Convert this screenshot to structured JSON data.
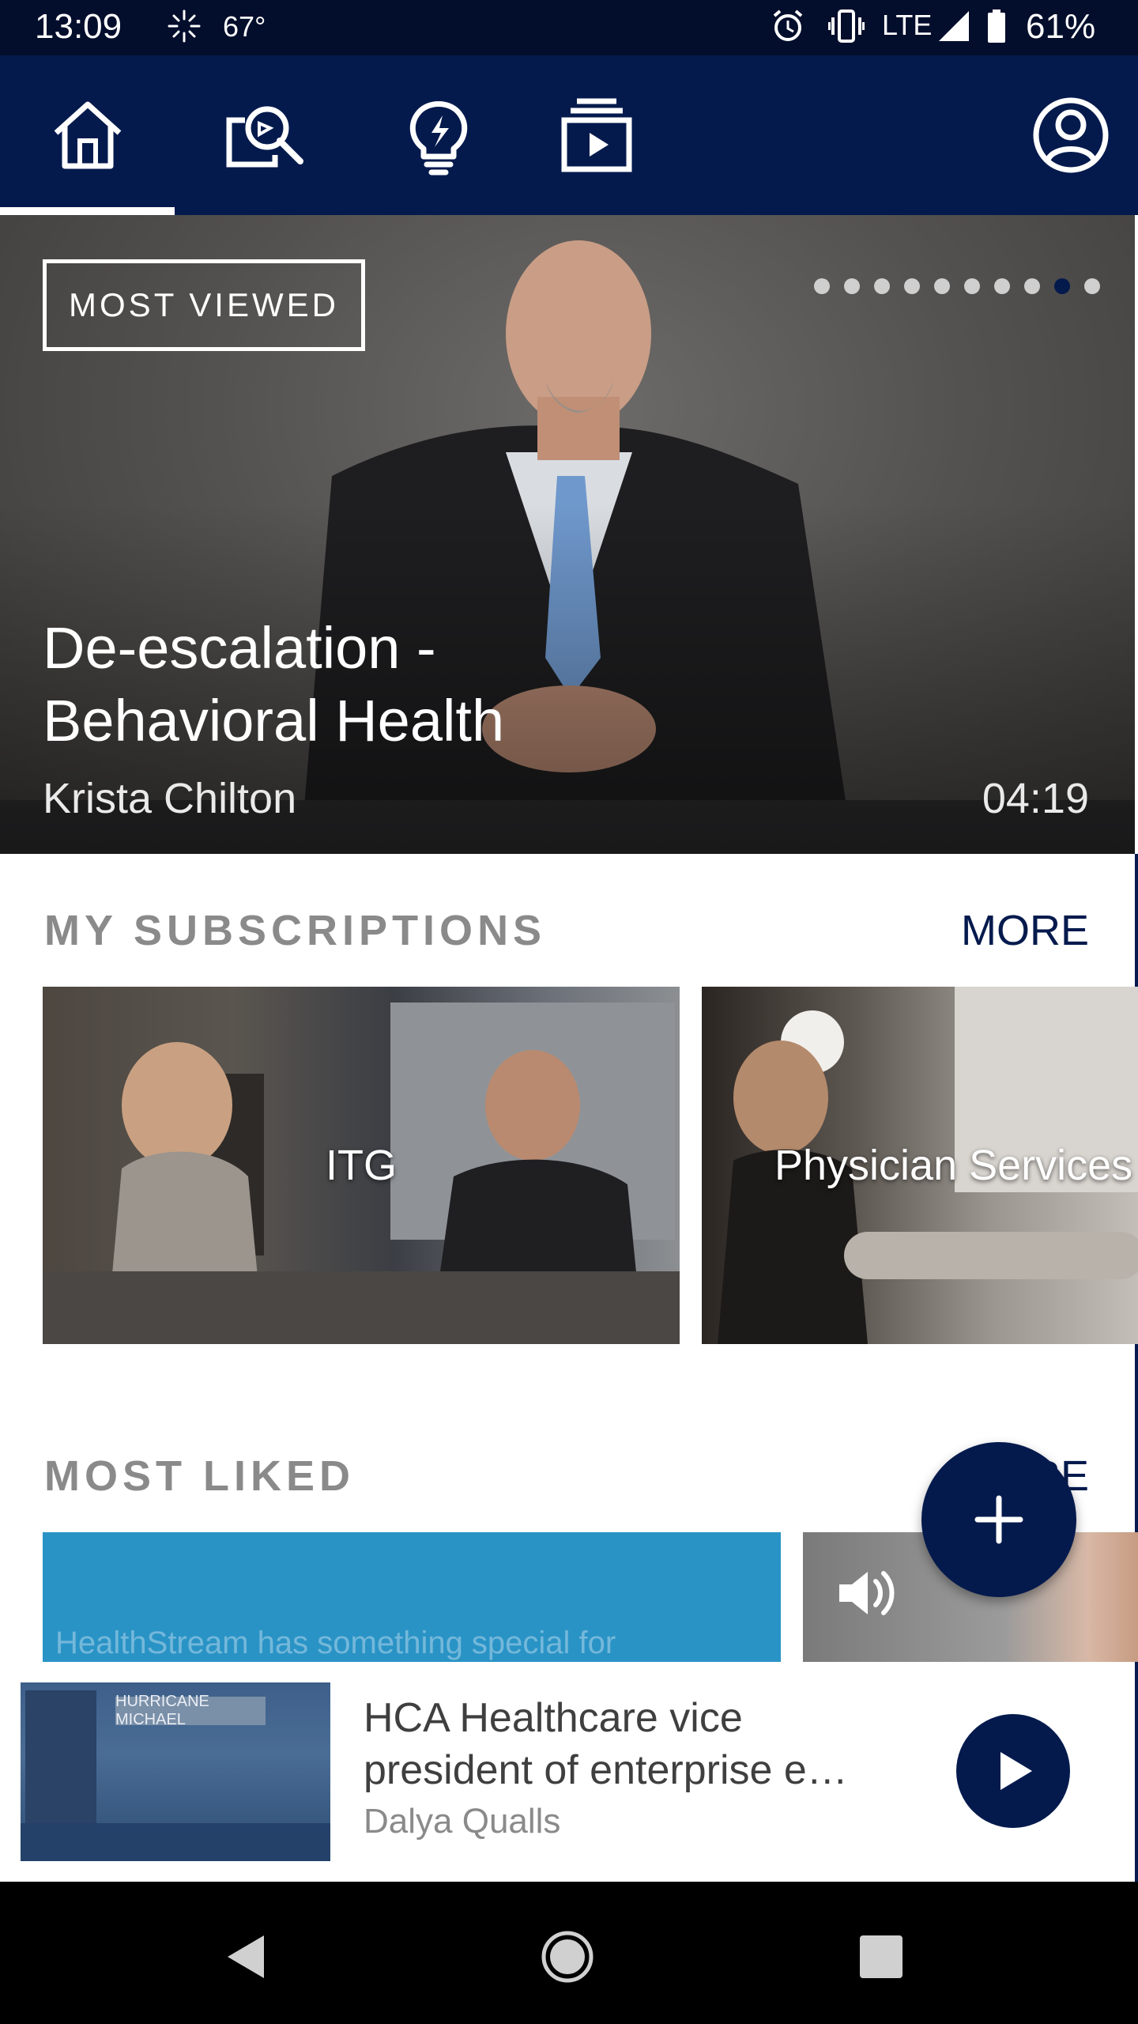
{
  "status_bar": {
    "time": "13:09",
    "temperature": "67°",
    "network": "LTE",
    "battery": "61%",
    "icons": [
      "weather-icon",
      "alarm-icon",
      "vibrate-icon",
      "signal-icon",
      "battery-icon"
    ]
  },
  "nav_tabs": [
    {
      "name": "home",
      "icon": "home-icon",
      "selected": true
    },
    {
      "name": "search",
      "icon": "search-icon",
      "selected": false
    },
    {
      "name": "ideas",
      "icon": "lightbulb-icon",
      "selected": false
    },
    {
      "name": "playlists",
      "icon": "playlist-icon",
      "selected": false
    },
    {
      "name": "profile",
      "icon": "profile-icon",
      "selected": false
    }
  ],
  "hero": {
    "badge": "MOST VIEWED",
    "title": "De-escalation - Behavioral Health",
    "author": "Krista Chilton",
    "duration": "04:19",
    "carousel_count": 10,
    "carousel_active_index": 8
  },
  "subscriptions": {
    "title": "MY SUBSCRIPTIONS",
    "more": "MORE",
    "cards": [
      {
        "label": "ITG"
      },
      {
        "label": "Physician Services"
      }
    ]
  },
  "most_liked": {
    "title": "MOST LIKED",
    "more": "MORE",
    "teaser": "HealthStream has something special for"
  },
  "mini_player": {
    "title": "HCA Healthcare vice president of enterprise e…",
    "author": "Dalya Qualls",
    "thumb_banner": "HURRICANE MICHAEL"
  },
  "colors": {
    "brand_navy": "#041a4d",
    "status_bar": "#030e2c",
    "section_gray": "#8a8a8a"
  }
}
